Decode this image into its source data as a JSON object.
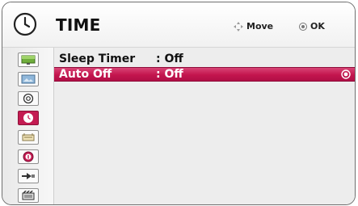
{
  "header": {
    "title": "TIME",
    "move_label": "Move",
    "ok_label": "OK",
    "clock_icon": "clock-icon"
  },
  "sidebar": {
    "items": [
      {
        "icon": "picture-icon",
        "active": false
      },
      {
        "icon": "screen-icon",
        "active": false
      },
      {
        "icon": "audio-icon",
        "active": false
      },
      {
        "icon": "time-icon",
        "active": true
      },
      {
        "icon": "setup-icon",
        "active": false
      },
      {
        "icon": "info-icon",
        "active": false
      },
      {
        "icon": "input-icon",
        "active": false
      },
      {
        "icon": "media-icon",
        "active": false
      }
    ]
  },
  "menu": {
    "rows": [
      {
        "label": "Sleep Timer",
        "value": ": Off",
        "selected": false
      },
      {
        "label": "Auto Off",
        "value": ": Off",
        "selected": true
      }
    ]
  },
  "colors": {
    "accent": "#c41b52",
    "panel_bg": "#ededed",
    "sidebar_bg": "#f0f0f0"
  }
}
